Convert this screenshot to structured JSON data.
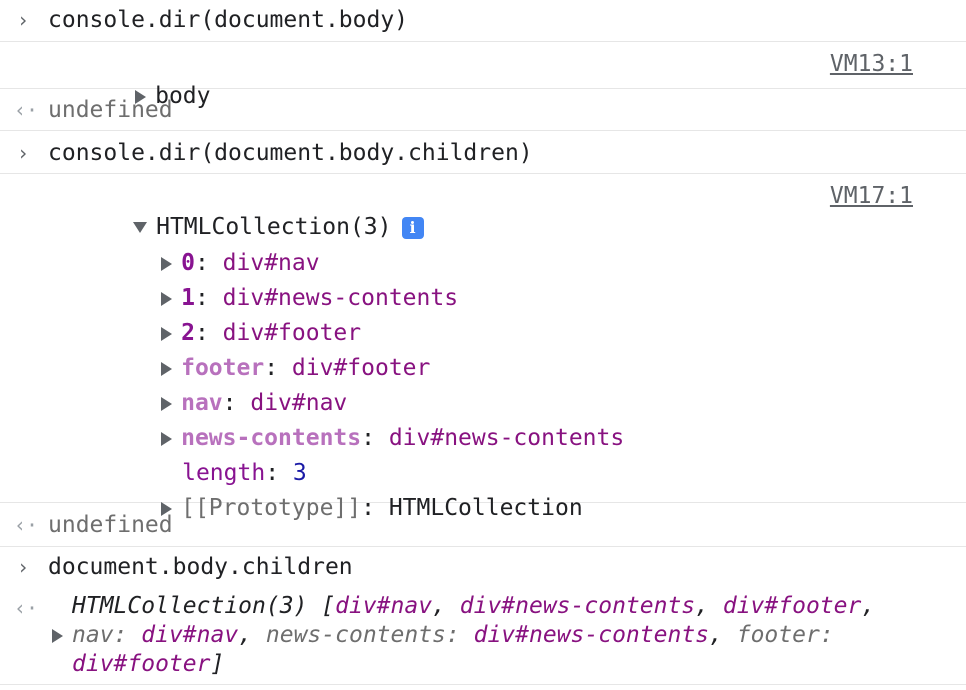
{
  "entries": [
    {
      "command": "console.dir(document.body)"
    },
    {
      "object_label": "body",
      "source": "VM13:1"
    },
    {
      "result": "undefined"
    },
    {
      "command": "console.dir(document.body.children)"
    },
    {
      "collection_label": "HTMLCollection(3)",
      "info_glyph": "i",
      "source": "VM17:1",
      "props": [
        {
          "key": "0",
          "value": "div#nav"
        },
        {
          "key": "1",
          "value": "div#news-contents"
        },
        {
          "key": "2",
          "value": "div#footer"
        },
        {
          "key": "footer",
          "value": "div#footer"
        },
        {
          "key": "nav",
          "value": "div#nav"
        },
        {
          "key": "news-contents",
          "value": "div#news-contents"
        },
        {
          "key": "length",
          "value": "3"
        },
        {
          "key": "[[Prototype]]",
          "value": "HTMLCollection"
        }
      ]
    },
    {
      "result": "undefined"
    },
    {
      "command": "document.body.children"
    },
    {
      "preview": {
        "label": "HTMLCollection(3) [",
        "items": [
          "div#nav",
          "div#news-contents",
          "div#footer"
        ],
        "named": [
          {
            "key": "nav",
            "value": "div#nav"
          },
          {
            "key": "news-contents",
            "value": "div#news-contents"
          },
          {
            "key": "footer",
            "value": "div#footer"
          }
        ],
        "close": "]"
      }
    }
  ],
  "glyphs": {
    "prompt": "›",
    "result": "‹·"
  }
}
